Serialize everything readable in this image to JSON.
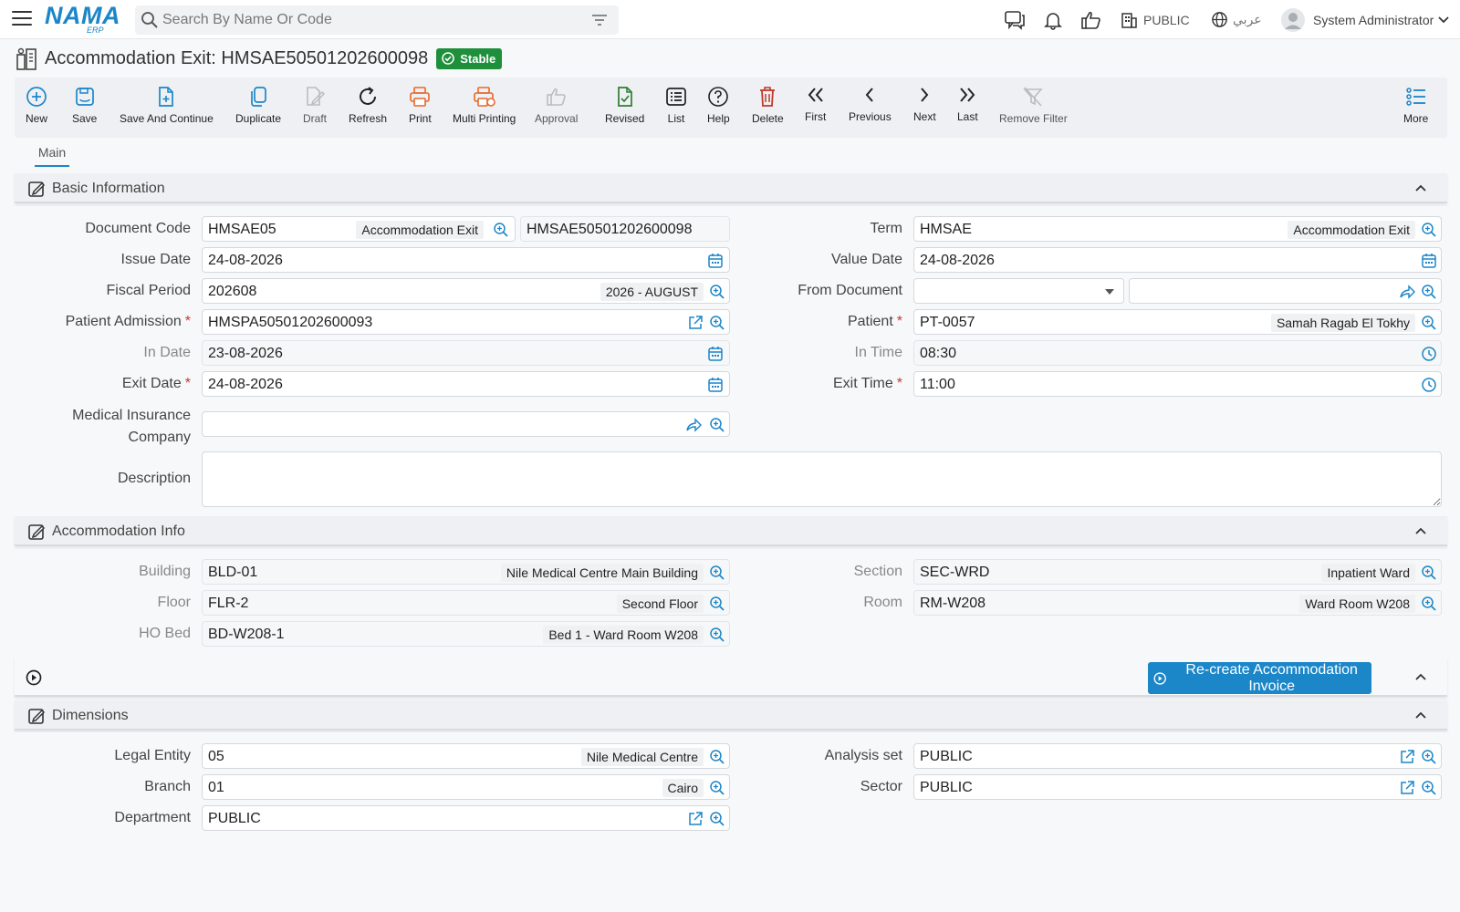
{
  "app": {
    "logo": "NAMA",
    "logo_sub": "ERP"
  },
  "search": {
    "placeholder": "Search By Name Or Code"
  },
  "topbar": {
    "company": "PUBLIC",
    "language": "عربي",
    "user": "System Administrator"
  },
  "page": {
    "title": "Accommodation Exit: HMSAE50501202600098",
    "status": "Stable"
  },
  "toolbar": {
    "new": "New",
    "save": "Save",
    "save_continue": "Save And Continue",
    "duplicate": "Duplicate",
    "draft": "Draft",
    "refresh": "Refresh",
    "print": "Print",
    "multi_printing": "Multi Printing",
    "approval": "Approval",
    "revised": "Revised",
    "list": "List",
    "help": "Help",
    "delete": "Delete",
    "first": "First",
    "previous": "Previous",
    "next": "Next",
    "last": "Last",
    "remove_filter": "Remove Filter",
    "more": "More"
  },
  "tabs": {
    "main": "Main"
  },
  "basic": {
    "title": "Basic Information",
    "document_code": {
      "label": "Document Code",
      "value": "HMSAE05",
      "desc": "Accommodation Exit",
      "code": "HMSAE50501202600098"
    },
    "term": {
      "label": "Term",
      "value": "HMSAE",
      "desc": "Accommodation Exit"
    },
    "issue_date": {
      "label": "Issue Date",
      "value": "24-08-2026"
    },
    "value_date": {
      "label": "Value Date",
      "value": "24-08-2026"
    },
    "fiscal_period": {
      "label": "Fiscal Period",
      "value": "202608",
      "desc": "2026 - AUGUST"
    },
    "from_document": {
      "label": "From Document",
      "value": ""
    },
    "patient_admission": {
      "label": "Patient Admission",
      "value": "HMSPA50501202600093"
    },
    "patient": {
      "label": "Patient",
      "value": "PT-0057",
      "desc": "Samah Ragab El Tokhy"
    },
    "in_date": {
      "label": "In Date",
      "value": "23-08-2026"
    },
    "in_time": {
      "label": "In Time",
      "value": "08:30"
    },
    "exit_date": {
      "label": "Exit Date",
      "value": "24-08-2026"
    },
    "exit_time": {
      "label": "Exit Time",
      "value": "11:00"
    },
    "insurance": {
      "label_1": "Medical Insurance",
      "label_2": "Company",
      "value": ""
    },
    "description": {
      "label": "Description",
      "value": ""
    }
  },
  "accommodation": {
    "title": "Accommodation Info",
    "building": {
      "label": "Building",
      "value": "BLD-01",
      "desc": "Nile Medical Centre Main Building"
    },
    "section": {
      "label": "Section",
      "value": "SEC-WRD",
      "desc": "Inpatient Ward"
    },
    "floor": {
      "label": "Floor",
      "value": "FLR-2",
      "desc": "Second Floor"
    },
    "room": {
      "label": "Room",
      "value": "RM-W208",
      "desc": "Ward Room W208"
    },
    "ho_bed": {
      "label": "HO Bed",
      "value": "BD-W208-1",
      "desc": "Bed 1 - Ward Room W208"
    }
  },
  "actions": {
    "recreate_invoice": "Re-create Accommodation Invoice"
  },
  "dimensions": {
    "title": "Dimensions",
    "legal_entity": {
      "label": "Legal Entity",
      "value": "05",
      "desc": "Nile Medical Centre"
    },
    "analysis_set": {
      "label": "Analysis set",
      "value": "PUBLIC"
    },
    "branch": {
      "label": "Branch",
      "value": "01",
      "desc": "Cairo"
    },
    "sector": {
      "label": "Sector",
      "value": "PUBLIC"
    },
    "department": {
      "label": "Department",
      "value": "PUBLIC"
    }
  },
  "colors": {
    "accent": "#1b86c8",
    "status": "#1e8f3b",
    "required": "#d6322b",
    "print": "#e8672a",
    "delete": "#c0392b",
    "revised": "#2e7d32"
  }
}
